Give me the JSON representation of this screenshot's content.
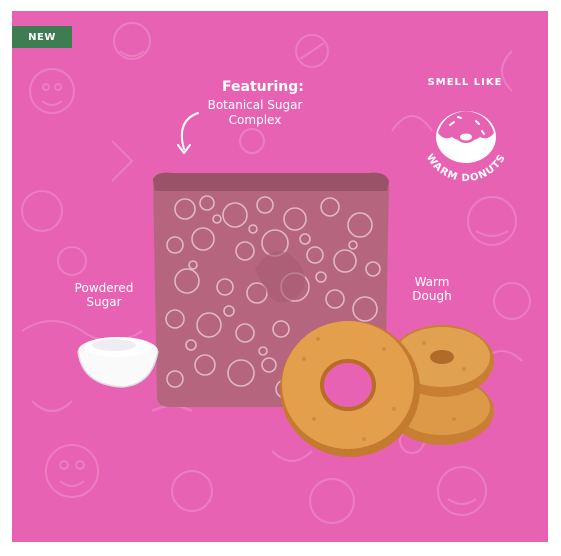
{
  "badge": {
    "label": "NEW"
  },
  "feature": {
    "title": "Featuring:",
    "line1": "Botanical Sugar",
    "line2": "Complex"
  },
  "smell": {
    "top": "SMELL LIKE",
    "bottom": "WARM DONUTS",
    "icon": "donut-icon"
  },
  "labels": {
    "sugar_line1": "Powdered",
    "sugar_line2": "Sugar",
    "dough_line1": "Warm",
    "dough_line2": "Dough"
  },
  "colors": {
    "background": "#e762b3",
    "badge": "#3e7d51",
    "soap": "#b5657e",
    "donut": "#d9923f"
  }
}
